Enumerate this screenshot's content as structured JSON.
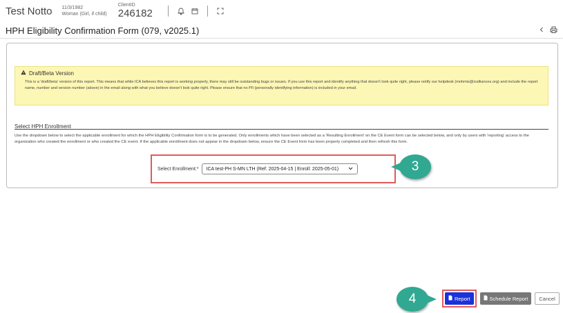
{
  "client": {
    "name": "Test Notto",
    "dob": "11/3/1982",
    "gender": "Woman (Girl, if child)",
    "id_label": "ClientID",
    "id_value": "246182"
  },
  "form": {
    "title": "HPH Eligibility Confirmation Form (079, v2025.1)"
  },
  "alert": {
    "title": "Draft/Beta Version",
    "body": "This is a 'draft/beta' version of this report. This means that while ICA believes this report is working properly, there may still be outstanding bugs or issues. If you use this report and identify anything that doesn't look quite right, please notify our helpdesk (mnhmis@icalliances.org) and include the report name, number and version number (above) in the email along with what you believe doesn't look quite right. Please ensure that no PII (personally identifying information) is included in your email."
  },
  "enrollment": {
    "section_title": "Select HPH Enrollment",
    "description": "Use the dropdown below to select the applicable enrollment for which the HPH Eligibility Confirmation form is to be generated. Only enrollments which have been selected as a 'Resulting Enrollment' on the CE Event form can be selected below, and only by users with 'reporting' access to the organization who created the enrollment or who created the CE event. If the applicable enrollment does not appear in the dropdown below, ensure the CE Event form has been properly completed and then refresh this form.",
    "label": "Select Enrollment:*",
    "selected": "ICA test-PH S-MN LTH (Ref: 2025-04-15 | Enroll: 2025-05-01)"
  },
  "callouts": {
    "step3": "3",
    "step4": "4"
  },
  "buttons": {
    "report": "Report",
    "schedule": "Schedule Report",
    "cancel": "Cancel"
  },
  "colors": {
    "alert_bg": "#fdf7b5",
    "callout": "#31a892",
    "highlight": "#e05a5a",
    "report_btn": "#1a32d8"
  },
  "icons": [
    "bell-icon",
    "calendar-icon",
    "expand-icon",
    "chevron-left-icon",
    "print-icon",
    "warning-icon",
    "document-icon"
  ]
}
